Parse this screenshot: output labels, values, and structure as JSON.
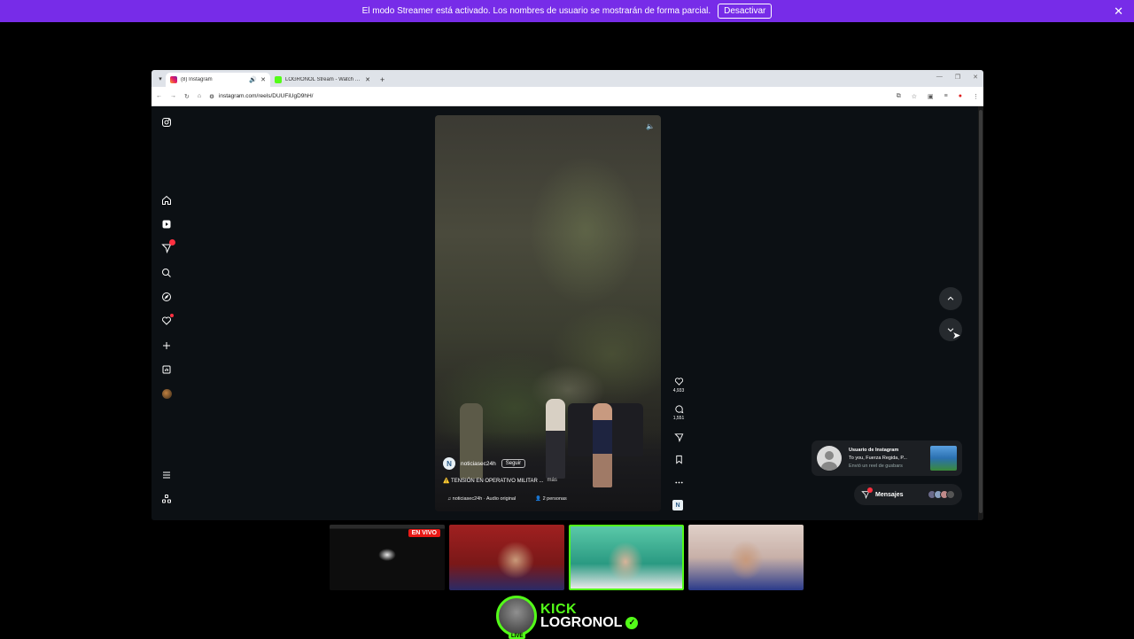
{
  "banner": {
    "message": "El modo Streamer está activado. Los nombres de usuario se mostrarán de forma parcial.",
    "deactivate_label": "Desactivar",
    "close_icon": "✕",
    "background": "#772ce8"
  },
  "browser": {
    "tabs": [
      {
        "label": "(8) Instagram",
        "icon": "instagram-icon",
        "active": true
      },
      {
        "label": "LOGRONOL Stream - Watch Li...",
        "icon": "kick-icon",
        "active": false
      }
    ],
    "new_tab": "+",
    "url": "instagram.com/reels/DUUFiUgD9hH/"
  },
  "instagram": {
    "reel": {
      "account": "noticiasec24h",
      "account_initial": "N",
      "follow_label": "Seguir",
      "caption": "⚠️ TENSIÓN EN OPERATIVO MILITAR ...",
      "more_label": "más",
      "audio": "noticiasec24h · Audio original",
      "people": "2 personas",
      "likes": "4,933",
      "comments": "1,551"
    },
    "notification": {
      "title": "Usuario de Instagram",
      "text": "To you, Fuerza Regida, P...",
      "subtext": "Envió un reel de gusbars"
    },
    "messages_label": "Mensajes",
    "colors": {
      "background": "#0c1014",
      "badge": "#ff3040"
    }
  },
  "stream": {
    "live_label": "EN VIVO",
    "brand": "KICK",
    "channel": "LOGRONOL",
    "avatar_badge": "LIVE",
    "verified_icon": "✓",
    "accent": "#53fc18"
  }
}
